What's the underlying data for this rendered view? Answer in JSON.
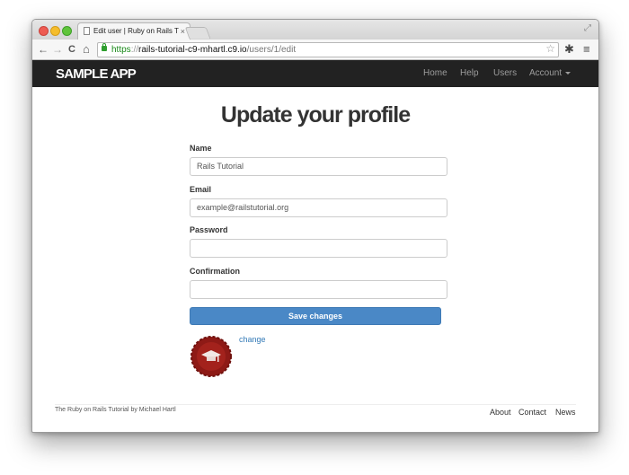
{
  "browser": {
    "tab_title": "Edit user | Ruby on Rails Tutorial",
    "tab_close": "×",
    "url_scheme": "https",
    "url_sep": "://",
    "url_host": "rails-tutorial-c9-mhartl.c9.io",
    "url_path": "/users/1/edit",
    "back_icon": "←",
    "forward_icon": "→",
    "reload_icon": "C",
    "home_icon": "⌂",
    "star_icon": "☆",
    "settings_icon": "✱",
    "menu_icon": "≡",
    "expand_icon": "⤢"
  },
  "navbar": {
    "logo": "SAMPLE APP",
    "links": [
      "Home",
      "Help",
      "Users",
      "Account"
    ],
    "background": "#222222"
  },
  "main": {
    "title": "Update your profile",
    "fields": [
      {
        "label": "Name",
        "value": "Rails Tutorial"
      },
      {
        "label": "Email",
        "value": "example@railstutorial.org"
      },
      {
        "label": "Password",
        "value": ""
      },
      {
        "label": "Confirmation",
        "value": ""
      }
    ],
    "submit_label": "Save changes",
    "change_link": "change",
    "accent": "#4a88c6"
  },
  "footer": {
    "text_start": "The ",
    "text_link1": "Ruby on Rails Tutorial",
    "text_by": " by ",
    "text_link2": "Michael Hartl",
    "links": [
      "About",
      "Contact",
      "News"
    ]
  }
}
